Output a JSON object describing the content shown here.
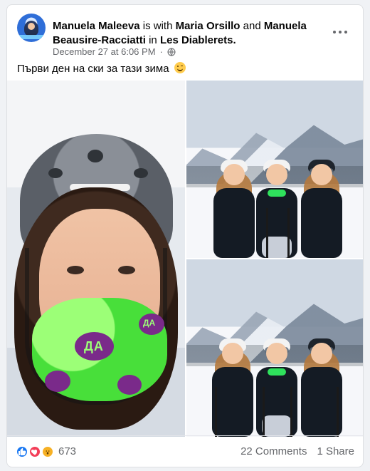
{
  "post": {
    "author": "Manuela Maleeva",
    "with_text": "is with",
    "tagged_1": "Maria Orsillo",
    "and_text": "and",
    "tagged_2": "Manuela Beausire-Racciatti",
    "in_text": "in",
    "location": "Les Diablerets.",
    "timestamp": "December 27 at 6:06 PM",
    "dot": "·",
    "caption": "Първи ден на ски за тази зима"
  },
  "mask": {
    "label": "ДА",
    "label_small": "ДА"
  },
  "footer": {
    "reaction_count": "673",
    "comments": "22 Comments",
    "shares": "1 Share"
  },
  "icons": {
    "privacy": "globe-icon",
    "more": "more-horizontal-icon",
    "like": "like-reaction-icon",
    "love": "love-reaction-icon",
    "wow": "wow-reaction-icon",
    "emoji": "smiling-face-emoji"
  },
  "colors": {
    "facebook_blue": "#1877f2",
    "meta_gray": "#65676b"
  }
}
